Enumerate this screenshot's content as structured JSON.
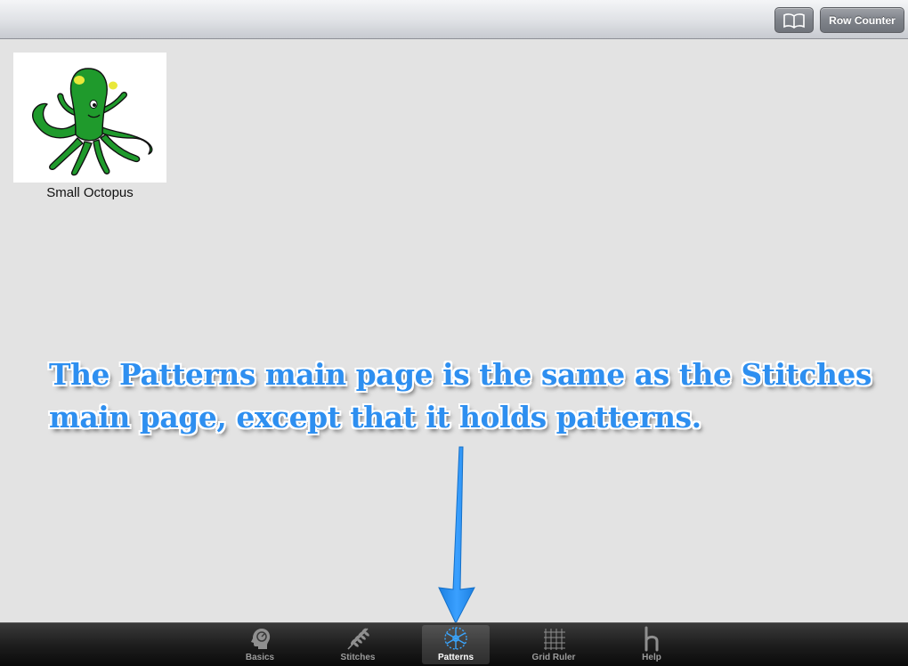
{
  "navbar": {
    "book_button_icon": "book-icon",
    "row_counter_label": "Row Counter"
  },
  "patterns": [
    {
      "name": "Small Octopus",
      "thumbnail_icon": "octopus-icon"
    }
  ],
  "annotation": {
    "text": "The Patterns main page is the same as the Stitches main page, except that it holds patterns.",
    "color": "#2e8ff0"
  },
  "tabbar": {
    "tabs": [
      {
        "label": "Basics",
        "icon": "head-icon",
        "selected": false
      },
      {
        "label": "Stitches",
        "icon": "wheat-icon",
        "selected": false
      },
      {
        "label": "Patterns",
        "icon": "snowflake-icon",
        "selected": true
      },
      {
        "label": "Grid Ruler",
        "icon": "grid-icon",
        "selected": false
      },
      {
        "label": "Help",
        "icon": "help-h-icon",
        "selected": false
      }
    ]
  }
}
